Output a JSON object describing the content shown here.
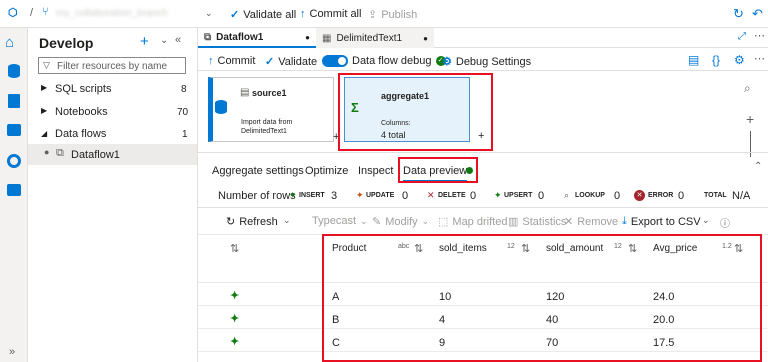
{
  "topbar": {
    "breadcrumb_sep": "/",
    "branch": "my_collaboration_branch",
    "validate_all": "Validate all",
    "commit_all": "Commit all",
    "publish": "Publish"
  },
  "sidebar": {
    "title": "Develop",
    "search_placeholder": "Filter resources by name",
    "items": [
      {
        "label": "SQL scripts",
        "count": "8"
      },
      {
        "label": "Notebooks",
        "count": "70"
      },
      {
        "label": "Data flows",
        "count": "1"
      }
    ],
    "child": "Dataflow1"
  },
  "tabs": [
    {
      "label": "Dataflow1"
    },
    {
      "label": "DelimitedText1"
    }
  ],
  "toolbar": {
    "commit": "Commit",
    "validate": "Validate",
    "debug": "Data flow debug",
    "debug_settings": "Debug Settings"
  },
  "canvas": {
    "source": {
      "title": "source1",
      "desc": "Import data from DelimitedText1"
    },
    "aggregate": {
      "title": "aggregate1",
      "columns_label": "Columns:",
      "columns_value": "4 total"
    }
  },
  "panel_tabs": [
    "Aggregate settings",
    "Optimize",
    "Inspect",
    "Data preview"
  ],
  "stats": {
    "label": "Number of rows",
    "insert": {
      "label": "INSERT",
      "value": "3"
    },
    "update": {
      "label": "UPDATE",
      "value": "0"
    },
    "delete": {
      "label": "DELETE",
      "value": "0"
    },
    "upsert": {
      "label": "UPSERT",
      "value": "0"
    },
    "lookup": {
      "label": "LOOKUP",
      "value": "0"
    },
    "error": {
      "label": "ERROR",
      "value": "0"
    },
    "total": {
      "label": "TOTAL",
      "value": "N/A"
    }
  },
  "actions": {
    "refresh": "Refresh",
    "typecast": "Typecast",
    "modify": "Modify",
    "map_drifted": "Map drifted",
    "statistics": "Statistics",
    "remove": "Remove",
    "export": "Export to CSV"
  },
  "table": {
    "columns": [
      {
        "name": "Product",
        "type": "abc"
      },
      {
        "name": "sold_items",
        "type": "12"
      },
      {
        "name": "sold_amount",
        "type": "12"
      },
      {
        "name": "Avg_price",
        "type": "1.2"
      }
    ],
    "rows": [
      [
        "A",
        "10",
        "120",
        "24.0"
      ],
      [
        "B",
        "4",
        "40",
        "20.0"
      ],
      [
        "C",
        "9",
        "70",
        "17.5"
      ]
    ]
  },
  "colors": {
    "accent": "#0078d4",
    "highlight": "#e81123",
    "ok": "#107c10"
  }
}
